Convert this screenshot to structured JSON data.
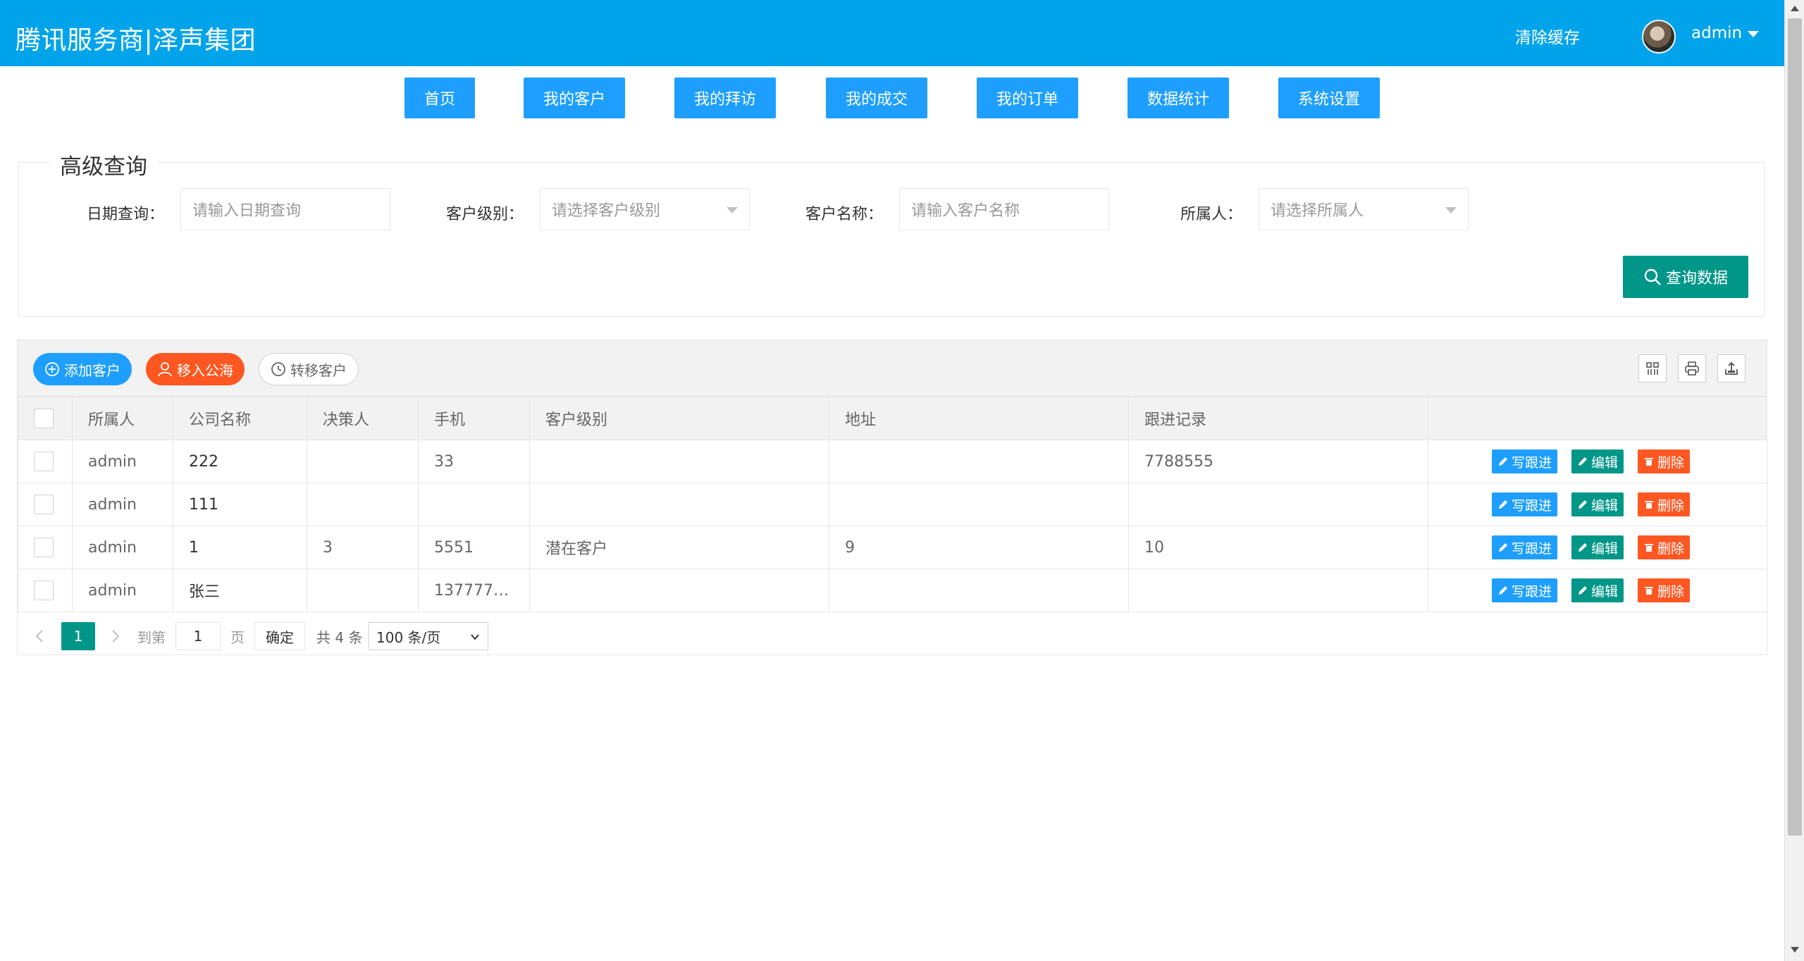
{
  "header": {
    "brand": "腾讯服务商|泽声集团",
    "clear_cache": "清除缓存",
    "username": "admin"
  },
  "nav": [
    "首页",
    "我的客户",
    "我的拜访",
    "我的成交",
    "我的订单",
    "数据统计",
    "系统设置"
  ],
  "query": {
    "legend": "高级查询",
    "date_label": "日期查询：",
    "date_placeholder": "请输入日期查询",
    "level_label": "客户级别：",
    "level_placeholder": "请选择客户级别",
    "name_label": "客户名称：",
    "name_placeholder": "请输入客户名称",
    "owner_label": "所属人：",
    "owner_placeholder": "请选择所属人",
    "submit": "查询数据"
  },
  "toolbar": {
    "add": "添加客户",
    "move_public": "移入公海",
    "transfer": "转移客户"
  },
  "table": {
    "headers": [
      "所属人",
      "公司名称",
      "决策人",
      "手机",
      "客户级别",
      "地址",
      "跟进记录"
    ],
    "rows": [
      {
        "owner": "admin",
        "company": "222",
        "decision": "",
        "phone": "33",
        "level": "",
        "address": "",
        "followup": "7788555"
      },
      {
        "owner": "admin",
        "company": "111",
        "decision": "",
        "phone": "",
        "level": "",
        "address": "",
        "followup": ""
      },
      {
        "owner": "admin",
        "company": "1",
        "decision": "3",
        "phone": "5551",
        "level": "潜在客户",
        "address": "9",
        "followup": "10"
      },
      {
        "owner": "admin",
        "company": "张三",
        "decision": "",
        "phone": "1377777…",
        "level": "",
        "address": "",
        "followup": ""
      }
    ],
    "actions": {
      "followup": "写跟进",
      "edit": "编辑",
      "delete": "删除"
    }
  },
  "pager": {
    "current": "1",
    "goto_label": "到第",
    "page_input": "1",
    "page_unit": "页",
    "confirm": "确定",
    "total": "共 4 条",
    "page_size": "100 条/页"
  },
  "colors": {
    "header": "#01a4ea",
    "nav_button": "#1e9fff",
    "primary_green": "#009688",
    "danger": "#ff5722"
  }
}
